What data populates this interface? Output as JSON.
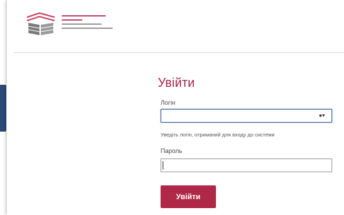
{
  "form": {
    "title": "Увійти",
    "login": {
      "label": "Логін",
      "value": "",
      "hint": "Уведіть логін, отриманий для входу до системи"
    },
    "password": {
      "label": "Пароль",
      "value": ""
    },
    "submit_label": "Увійти"
  },
  "icons": [
    "logo-emblem",
    "key-toggle-icon"
  ],
  "colors": {
    "accent": "#b02848",
    "title": "#a8244a",
    "focus_border": "#3b5c96",
    "side_tab": "#2b4a78",
    "divider": "#d7d7d7"
  }
}
